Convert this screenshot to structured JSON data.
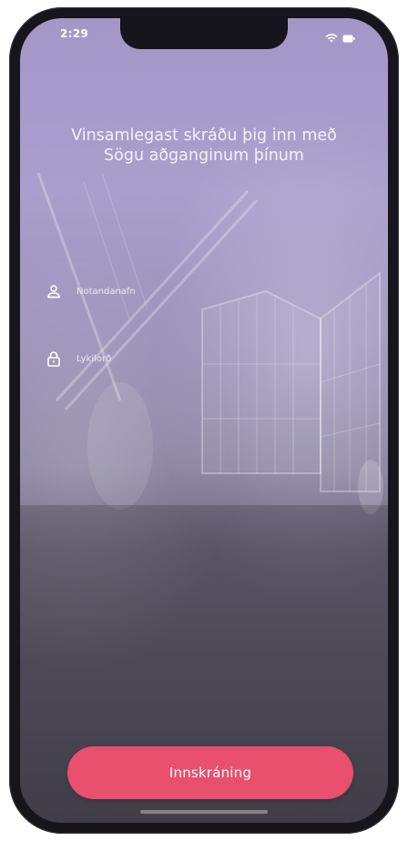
{
  "status_bar": {
    "time": "2:29",
    "icons": [
      "wifi-icon",
      "battery-icon"
    ]
  },
  "heading": {
    "line1": "Vinsamlegast skráðu þig inn með",
    "line2": "Sögu aðganginum þínum"
  },
  "form": {
    "username": {
      "placeholder": "Notandanafn",
      "value": "",
      "icon": "user-icon"
    },
    "password": {
      "placeholder": "Lykilorð",
      "value": "",
      "icon": "lock-icon"
    }
  },
  "login_button": {
    "label": "Innskráning",
    "color": "#e8506e"
  },
  "colors": {
    "background_top": "#a397c8",
    "background_bottom": "#4a4652",
    "text": "#f4f1fb"
  }
}
